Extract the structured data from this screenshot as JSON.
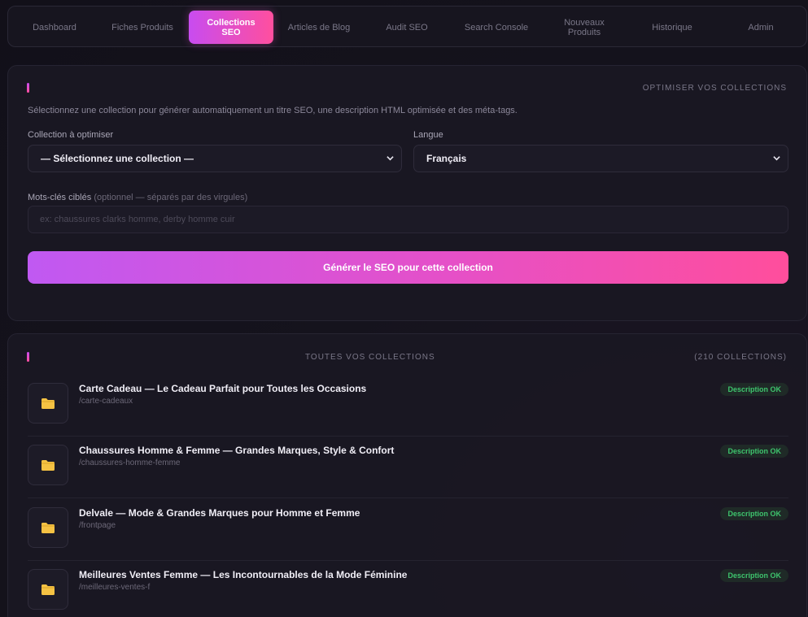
{
  "nav": {
    "items": [
      {
        "label": "Dashboard"
      },
      {
        "label": "Fiches Produits"
      },
      {
        "label": "Collections SEO",
        "active": true
      },
      {
        "label": "Articles de Blog"
      },
      {
        "label": "Audit SEO"
      },
      {
        "label": "Search Console"
      },
      {
        "label": "Nouveaux Produits"
      },
      {
        "label": "Historique"
      },
      {
        "label": "Admin"
      }
    ]
  },
  "optimize": {
    "title": "OPTIMISER VOS COLLECTIONS",
    "description": "Sélectionnez une collection pour générer automatiquement un titre SEO, une description HTML optimisée et des méta-tags.",
    "collection_label": "Collection à optimiser",
    "collection_value": "— Sélectionnez une collection —",
    "language_label": "Langue",
    "language_value": "Français",
    "keywords_label": "Mots-clés ciblés",
    "keywords_hint": "(optionnel — séparés par des virgules)",
    "keywords_placeholder": "ex: chaussures clarks homme, derby homme cuir",
    "generate_button": "Générer le SEO pour cette collection"
  },
  "collections": {
    "title": "TOUTES VOS COLLECTIONS",
    "count": "(210 COLLECTIONS)",
    "items": [
      {
        "title": "Carte Cadeau — Le Cadeau Parfait pour Toutes les Occasions",
        "handle": "/carte-cadeaux",
        "status": "Description OK"
      },
      {
        "title": "Chaussures Homme & Femme — Grandes Marques, Style & Confort",
        "handle": "/chaussures-homme-femme",
        "status": "Description OK"
      },
      {
        "title": "Delvale — Mode & Grandes Marques pour Homme et Femme",
        "handle": "/frontpage",
        "status": "Description OK"
      },
      {
        "title": "Meilleures Ventes Femme — Les Incontournables de la Mode Féminine",
        "handle": "/meilleures-ventes-f",
        "status": "Description OK"
      }
    ],
    "item_icon": "folder-icon"
  },
  "colors": {
    "accent_start": "#c84cf0",
    "accent_end": "#ff4f9e",
    "status_ok": "#3ec46d",
    "folder": "#f5c243"
  }
}
